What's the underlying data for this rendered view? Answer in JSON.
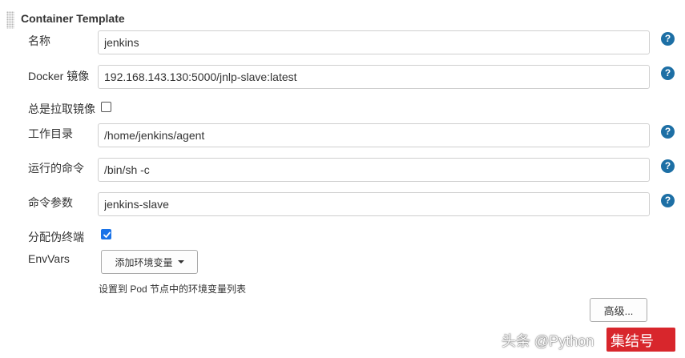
{
  "section": {
    "title": "Container Template"
  },
  "fields": {
    "name": {
      "label": "名称",
      "value": "jenkins"
    },
    "docker_image": {
      "label": "Docker 镜像",
      "value": "192.168.143.130:5000/jnlp-slave:latest"
    },
    "always_pull": {
      "label": "总是拉取镜像",
      "checked": false
    },
    "working_dir": {
      "label": "工作目录",
      "value": "/home/jenkins/agent"
    },
    "command": {
      "label": "运行的命令",
      "value": "/bin/sh -c"
    },
    "args": {
      "label": "命令参数",
      "value": "jenkins-slave"
    },
    "allocate_tty": {
      "label": "分配伪终端",
      "checked": true
    },
    "env_vars": {
      "label": "EnvVars",
      "add_button_label": "添加环境变量",
      "hint": "设置到 Pod 节点中的环境变量列表"
    }
  },
  "help_icon_glyph": "?",
  "advanced_button_label": "高级...",
  "watermark": {
    "text": "头条 @Python",
    "badge_text": "集结号"
  },
  "colors": {
    "help_icon": "#1d6fa5",
    "checkbox_checked": "#1a73e8",
    "watermark_badge": "#d8262c"
  }
}
